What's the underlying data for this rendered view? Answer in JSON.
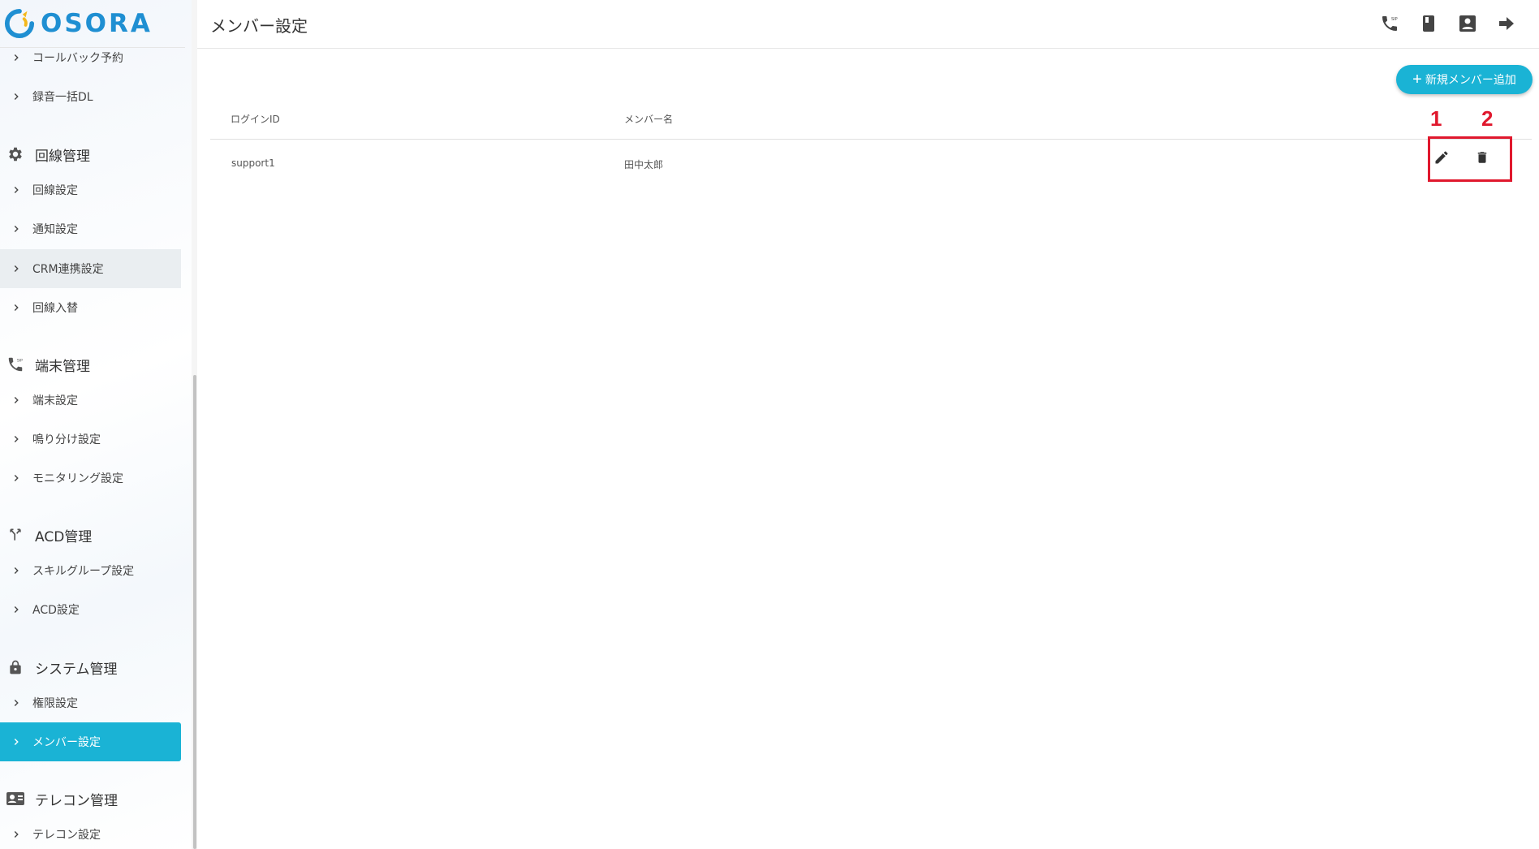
{
  "brand": {
    "name": "OSORA",
    "accent_color": "#1ab3d5",
    "logo_color": "#1f8fd2"
  },
  "sidebar": {
    "items_top": [
      {
        "label": "コールバック予約"
      },
      {
        "label": "録音一括DL"
      }
    ],
    "sections": [
      {
        "title": "回線管理",
        "icon": "gear-icon",
        "items": [
          {
            "label": "回線設定"
          },
          {
            "label": "通知設定"
          },
          {
            "label": "CRM連携設定"
          },
          {
            "label": "回線入替"
          }
        ]
      },
      {
        "title": "端末管理",
        "icon": "sip-phone-icon",
        "items": [
          {
            "label": "端末設定"
          },
          {
            "label": "鳴り分け設定"
          },
          {
            "label": "モニタリング設定"
          }
        ]
      },
      {
        "title": "ACD管理",
        "icon": "call-split-icon",
        "items": [
          {
            "label": "スキルグループ設定"
          },
          {
            "label": "ACD設定"
          }
        ]
      },
      {
        "title": "システム管理",
        "icon": "lock-icon",
        "items": [
          {
            "label": "権限設定"
          },
          {
            "label": "メンバー設定"
          }
        ]
      },
      {
        "title": "テレコン管理",
        "icon": "contact-card-icon",
        "items": [
          {
            "label": "テレコン設定"
          }
        ]
      }
    ]
  },
  "header": {
    "title": "メンバー設定",
    "icons": [
      "sip-phone-icon",
      "book-icon",
      "account-box-icon",
      "logout-arrow-icon"
    ]
  },
  "main": {
    "add_button_label": "新規メンバー追加",
    "table": {
      "columns": [
        "ログインID",
        "メンバー名"
      ],
      "rows": [
        {
          "login_id": "support1",
          "member_name": "田中太郎"
        }
      ]
    }
  },
  "annotations": {
    "color": "#e0182d",
    "labels": [
      "1",
      "2"
    ]
  }
}
